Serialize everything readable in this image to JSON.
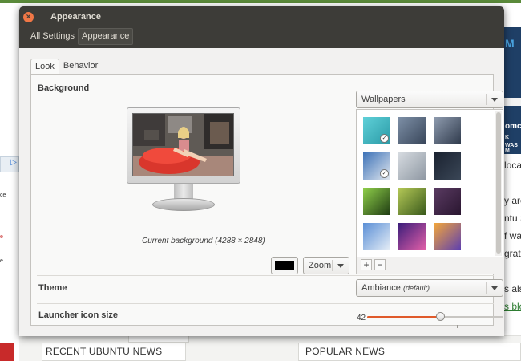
{
  "background_page": {
    "left_ad_badge": "▷",
    "left_fragments": [
      "ce",
      "e",
      "e"
    ],
    "right_ad_lines": [
      "M",
      "omc",
      "K",
      "WAS M"
    ],
    "right_text_lines": [
      "loca",
      "",
      "y are",
      "ntu S",
      "f wa",
      "grat",
      "",
      "s als",
      "s blo"
    ],
    "bottom_headings": [
      "RECENT UBUNTU NEWS",
      "POPULAR NEWS"
    ]
  },
  "window": {
    "title": "Appearance",
    "close_glyph": "×",
    "breadcrumbs": [
      "All Settings",
      "Appearance"
    ]
  },
  "tabs": [
    {
      "label": "Look",
      "active": true
    },
    {
      "label": "Behavior",
      "active": false
    }
  ],
  "background_section": {
    "label": "Background",
    "current_background_text": "Current background (4288 × 2848)",
    "wallpaper_source": "Wallpapers",
    "color_value": "#000000",
    "zoom_value": "Zoom",
    "wallpapers": [
      {
        "name": "teal-sparkles",
        "colors": [
          "#5fd0d8",
          "#2a9aa6"
        ],
        "selected": true
      },
      {
        "name": "blue-droplet",
        "colors": [
          "#7d8fa6",
          "#39465a"
        ],
        "selected": false
      },
      {
        "name": "water-drop",
        "colors": [
          "#8f9caf",
          "#2f3a4c"
        ],
        "selected": false
      },
      {
        "name": "snowy-mountains",
        "colors": [
          "#3e73b8",
          "#dfe6ee"
        ],
        "selected": true
      },
      {
        "name": "grey-smoke",
        "colors": [
          "#d6dbe0",
          "#8f98a3"
        ],
        "selected": false
      },
      {
        "name": "dark-night",
        "colors": [
          "#1a2230",
          "#3a4656"
        ],
        "selected": false
      },
      {
        "name": "green-leaf",
        "colors": [
          "#8fcf4a",
          "#1e3b12"
        ],
        "selected": false
      },
      {
        "name": "grass-blades",
        "colors": [
          "#b4c856",
          "#3a5a1c"
        ],
        "selected": false
      },
      {
        "name": "purple-bubble",
        "colors": [
          "#5a3b62",
          "#2a1630"
        ],
        "selected": false
      },
      {
        "name": "blue-peaks",
        "colors": [
          "#5b8fd6",
          "#e6eef6"
        ],
        "selected": false
      },
      {
        "name": "purple-sunset",
        "colors": [
          "#3b1d7a",
          "#e25fa8"
        ],
        "selected": false
      },
      {
        "name": "rainbow-stripes",
        "colors": [
          "#f4a73a",
          "#5d3fb0"
        ],
        "selected": false
      }
    ],
    "add_label": "+",
    "remove_label": "−"
  },
  "theme_section": {
    "label": "Theme",
    "value": "Ambiance",
    "value_suffix": "(default)"
  },
  "launcher_section": {
    "label": "Launcher icon size",
    "value": "42",
    "fraction": 0.54
  }
}
